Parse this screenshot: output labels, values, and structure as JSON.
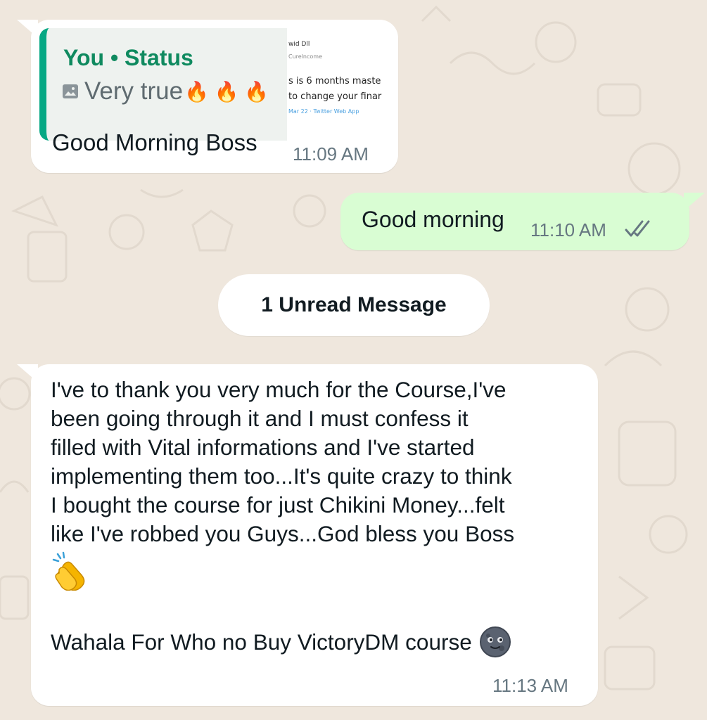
{
  "chat": {
    "messages": [
      {
        "direction": "incoming",
        "reply_quote": {
          "author": "You • Status",
          "text": "Very true",
          "attachment_icon": "image-icon",
          "emoji": "🔥 🔥 🔥",
          "thumbnail_lines": [
            "wid Dll",
            "Curelncome",
            "s is 6 months maste",
            "to change your finar",
            "Mar 22 · Twitter Web App"
          ]
        },
        "text": "Good Morning Boss",
        "time": "11:09 AM"
      },
      {
        "direction": "outgoing",
        "text": "Good morning",
        "time": "11:10 AM",
        "status_icon": "double-check-icon"
      },
      {
        "divider": "1 Unread Message"
      },
      {
        "direction": "incoming",
        "text_lines": [
          "I've to thank you very much for the Course,I've",
          "been going through it and I must confess it",
          "filled with Vital informations and I've started",
          "implementing them too...It's quite crazy to think",
          "I bought the course for just Chikini Money...felt",
          "like I've robbed you Guys...God bless you Boss"
        ],
        "emoji_icon": "clapping-hands-icon",
        "footer_text": "Wahala For Who no Buy VictoryDM course",
        "footer_emoji_icon": "new-moon-face-icon",
        "time": "11:13 AM"
      }
    ]
  },
  "colors": {
    "background": "#efe7dd",
    "incoming_bubble": "#ffffff",
    "outgoing_bubble": "#d9fdd3",
    "quote_accent": "#06a884",
    "quote_author": "#0f8a5f",
    "timestamp": "#667781",
    "read_ticks": "#667781"
  }
}
